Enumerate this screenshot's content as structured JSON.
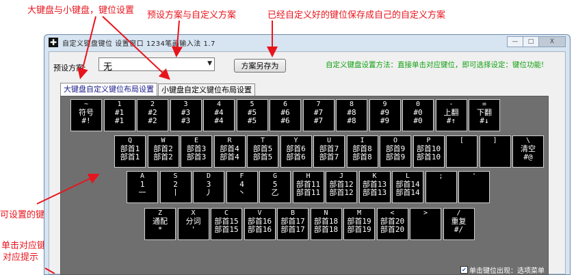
{
  "annotations": {
    "top_left": "大键盘与小键盘，键位设置",
    "top_mid": "预设方案与自定义方案",
    "top_right": "已经自定义好的键位保存成自己的自定义方案",
    "left_mid": "可设置的键盘键位",
    "left_bottom_1": "单击对应键位时，",
    "left_bottom_2": "对应提示"
  },
  "window": {
    "title": "自定义键盘键位 设置窗口 1234笔画输入法 1.7",
    "minimize": "—",
    "maximize": "□",
    "close": "X"
  },
  "toolbar": {
    "preset_label": "预设方案:",
    "preset_value": "无",
    "save_button": "方案另存为",
    "hint": "自定义键盘设置方法：直接单击对应键位，即可选择设定：键位功能!"
  },
  "tabs": [
    "大键盘自定义键位布局设置",
    "小键盘自定义键位布局设置"
  ],
  "keyboard": {
    "rows": [
      [
        {
          "top": "~",
          "mid": "符号",
          "bot": "#!"
        },
        {
          "top": "1",
          "mid": "#1",
          "bot": "#1"
        },
        {
          "top": "2",
          "mid": "#2",
          "bot": "#2"
        },
        {
          "top": "3",
          "mid": "#3",
          "bot": "#3"
        },
        {
          "top": "4",
          "mid": "#4",
          "bot": "#4"
        },
        {
          "top": "5",
          "mid": "#5",
          "bot": "#5"
        },
        {
          "top": "6",
          "mid": "#6",
          "bot": "#6"
        },
        {
          "top": "7",
          "mid": "#7",
          "bot": "#7"
        },
        {
          "top": "8",
          "mid": "#8",
          "bot": "#8"
        },
        {
          "top": "9",
          "mid": "#9",
          "bot": "#9"
        },
        {
          "top": "0",
          "mid": "#0",
          "bot": "#0"
        },
        {
          "top": "-",
          "mid": "上翻",
          "bot": "#↑"
        },
        {
          "top": "=",
          "mid": "下翻",
          "bot": "#↓"
        }
      ],
      [
        {
          "top": "Q",
          "mid": "部首1",
          "bot": "部首1"
        },
        {
          "top": "W",
          "mid": "部首2",
          "bot": "部首2"
        },
        {
          "top": "E",
          "mid": "部首3",
          "bot": "部首3"
        },
        {
          "top": "R",
          "mid": "部首4",
          "bot": "部首4"
        },
        {
          "top": "T",
          "mid": "部首5",
          "bot": "部首5"
        },
        {
          "top": "Y",
          "mid": "部首6",
          "bot": "部首6"
        },
        {
          "top": "U",
          "mid": "部首7",
          "bot": "部首7"
        },
        {
          "top": "I",
          "mid": "部首8",
          "bot": "部首8"
        },
        {
          "top": "O",
          "mid": "部首9",
          "bot": "部首9"
        },
        {
          "top": "P",
          "mid": "部首10",
          "bot": "部首10"
        },
        {
          "top": "[",
          "mid": "",
          "bot": ""
        },
        {
          "top": "]",
          "mid": "",
          "bot": ""
        },
        {
          "top": "\\",
          "mid": "清空",
          "bot": "#@"
        }
      ],
      [
        {
          "top": "A",
          "mid": "1",
          "bot": "一"
        },
        {
          "top": "S",
          "mid": "2",
          "bot": "丨"
        },
        {
          "top": "D",
          "mid": "3",
          "bot": "丿"
        },
        {
          "top": "F",
          "mid": "4",
          "bot": "丶"
        },
        {
          "top": "G",
          "mid": "5",
          "bot": "乙"
        },
        {
          "top": "H",
          "mid": "部首11",
          "bot": "部首11"
        },
        {
          "top": "J",
          "mid": "部首12",
          "bot": "部首12"
        },
        {
          "top": "K",
          "mid": "部首13",
          "bot": "部首13"
        },
        {
          "top": "L",
          "mid": "部首14",
          "bot": "部首14"
        },
        {
          "top": ";",
          "mid": "",
          "bot": ""
        },
        {
          "top": "'",
          "mid": "",
          "bot": ""
        }
      ],
      [
        {
          "top": "Z",
          "mid": "通配",
          "bot": "*"
        },
        {
          "top": "X",
          "mid": "分词",
          "bot": "'"
        },
        {
          "top": "C",
          "mid": "部首15",
          "bot": "部首15"
        },
        {
          "top": "V",
          "mid": "部首16",
          "bot": "部首16"
        },
        {
          "top": "B",
          "mid": "部首17",
          "bot": "部首17"
        },
        {
          "top": "N",
          "mid": "部首18",
          "bot": "部首18"
        },
        {
          "top": "M",
          "mid": "部首19",
          "bot": "部首19"
        },
        {
          "top": "<",
          "mid": "部首20",
          "bot": "部首20"
        },
        {
          "top": ">",
          "mid": "",
          "bot": ""
        },
        {
          "top": "/",
          "mid": "重复",
          "bot": "#/"
        }
      ]
    ],
    "checkbox_label": "单击键位出现：选项菜单",
    "checkbox_checked": true
  },
  "colors": {
    "annotation": "#e8141c",
    "hint": "#11a011",
    "key_bg": "#000000",
    "panel_bg": "#6f6f6f"
  }
}
